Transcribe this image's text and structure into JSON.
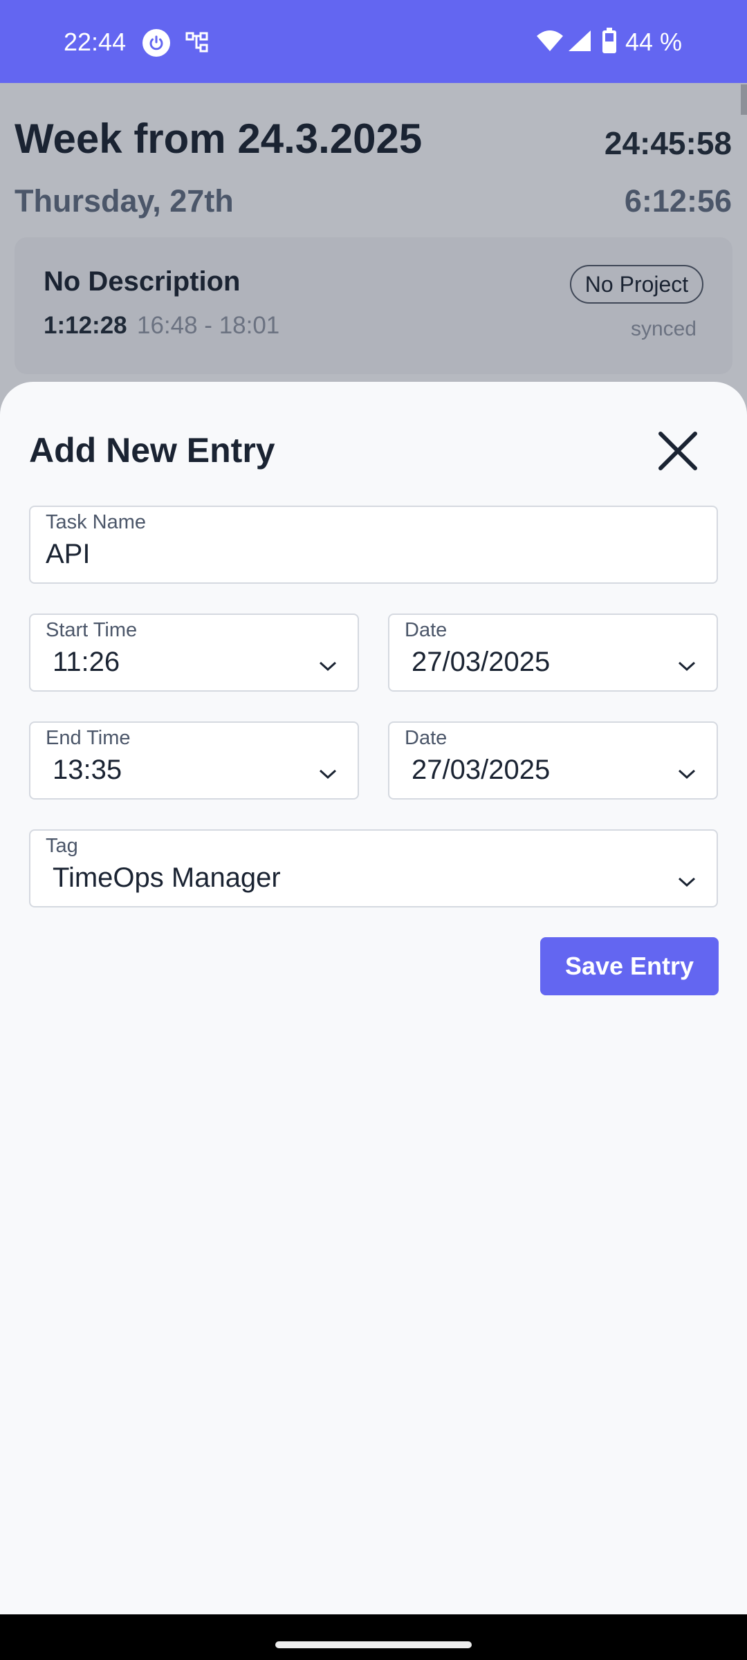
{
  "status_bar": {
    "time": "22:44",
    "battery": "44 %",
    "icons": [
      "power-icon",
      "network-icon",
      "wifi-icon",
      "signal-icon",
      "battery-icon"
    ]
  },
  "week": {
    "title": "Week from 24.3.2025",
    "total": "24:45:58"
  },
  "day": {
    "title": "Thursday, 27th",
    "total": "6:12:56"
  },
  "entry": {
    "description": "No Description",
    "project": "No Project",
    "duration": "1:12:28",
    "range": "16:48 - 18:01",
    "sync_status": "synced"
  },
  "sheet": {
    "title": "Add New Entry",
    "task": {
      "label": "Task Name",
      "value": "API"
    },
    "start_time": {
      "label": "Start Time",
      "value": "11:26"
    },
    "start_date": {
      "label": "Date",
      "value": "27/03/2025"
    },
    "end_time": {
      "label": "End Time",
      "value": "13:35"
    },
    "end_date": {
      "label": "Date",
      "value": "27/03/2025"
    },
    "tag": {
      "label": "Tag",
      "value": "TimeOps Manager"
    },
    "save_label": "Save Entry"
  },
  "colors": {
    "accent": "#6366f1",
    "overlay": "#b6b9c0",
    "sheet_bg": "#f8f9fb",
    "text_dark": "#1a2332"
  }
}
